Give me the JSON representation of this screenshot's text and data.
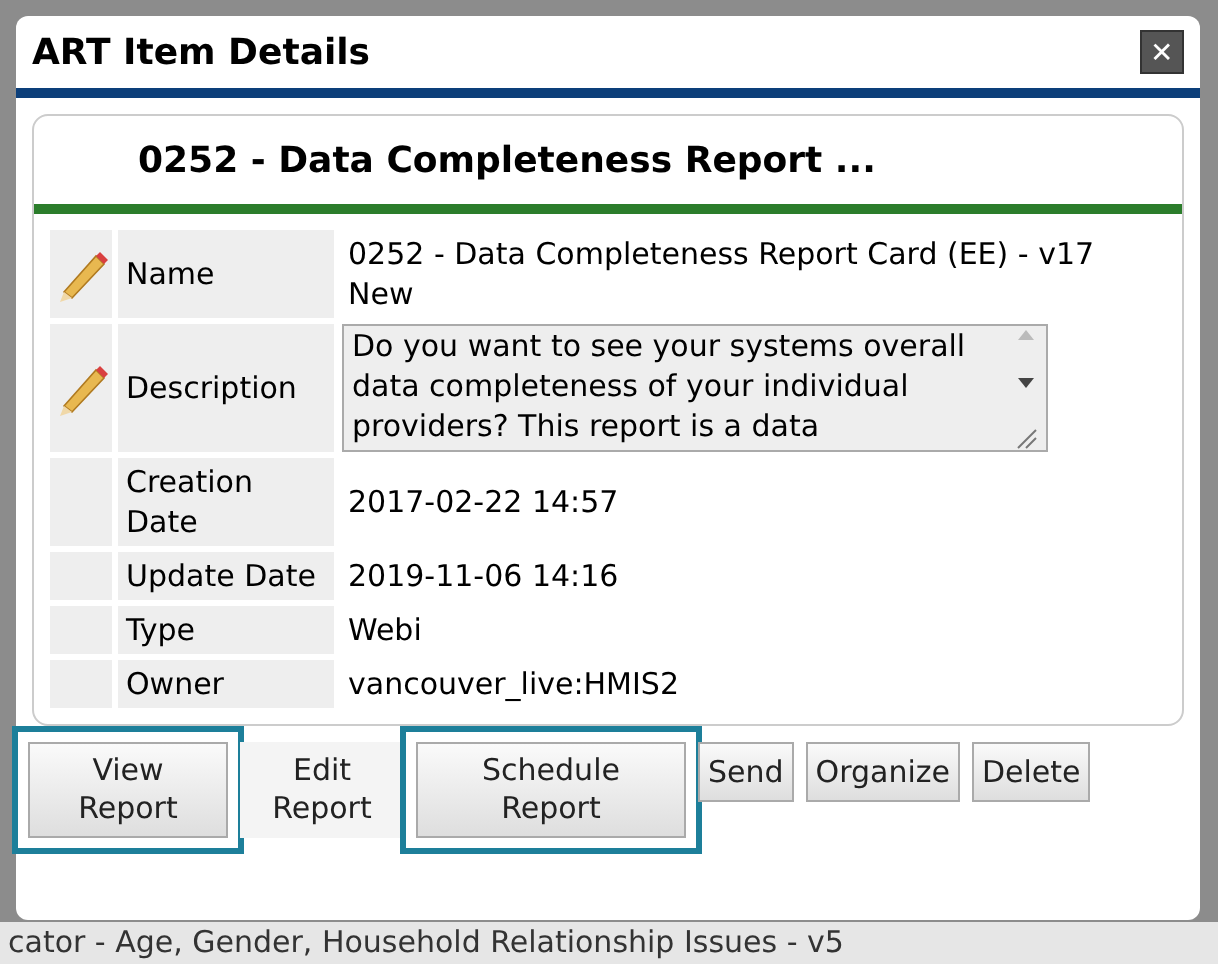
{
  "window": {
    "title": "ART Item Details",
    "close": "✕"
  },
  "card": {
    "title": "0252 - Data Completeness Report ..."
  },
  "fields": [
    {
      "kind": "text",
      "editable": true,
      "label": "Name",
      "value": "0252 - Data Completeness Report Card (EE) - v17 New"
    },
    {
      "kind": "textarea",
      "editable": true,
      "label": "Description",
      "value": "Do you want to see your systems overall data completeness of your individual providers? This report is a data"
    },
    {
      "kind": "text",
      "editable": false,
      "label": "Creation Date",
      "value": "2017-02-22 14:57"
    },
    {
      "kind": "text",
      "editable": false,
      "label": "Update Date",
      "value": "2019-11-06 14:16"
    },
    {
      "kind": "text",
      "editable": false,
      "label": "Type",
      "value": "Webi"
    },
    {
      "kind": "text",
      "editable": false,
      "label": "Owner",
      "value": "vancouver_live:HMIS2"
    }
  ],
  "buttons": [
    {
      "label": "View Report",
      "highlighted": true,
      "flat": false
    },
    {
      "label": "Edit Report",
      "highlighted": false,
      "flat": true
    },
    {
      "label": "Schedule Report",
      "highlighted": true,
      "flat": false
    },
    {
      "label": "Send",
      "highlighted": false,
      "flat": false
    },
    {
      "label": "Organize",
      "highlighted": false,
      "flat": false
    },
    {
      "label": "Delete",
      "highlighted": false,
      "flat": false
    }
  ],
  "background_text": "cator - Age, Gender, Household Relationship Issues - v5"
}
